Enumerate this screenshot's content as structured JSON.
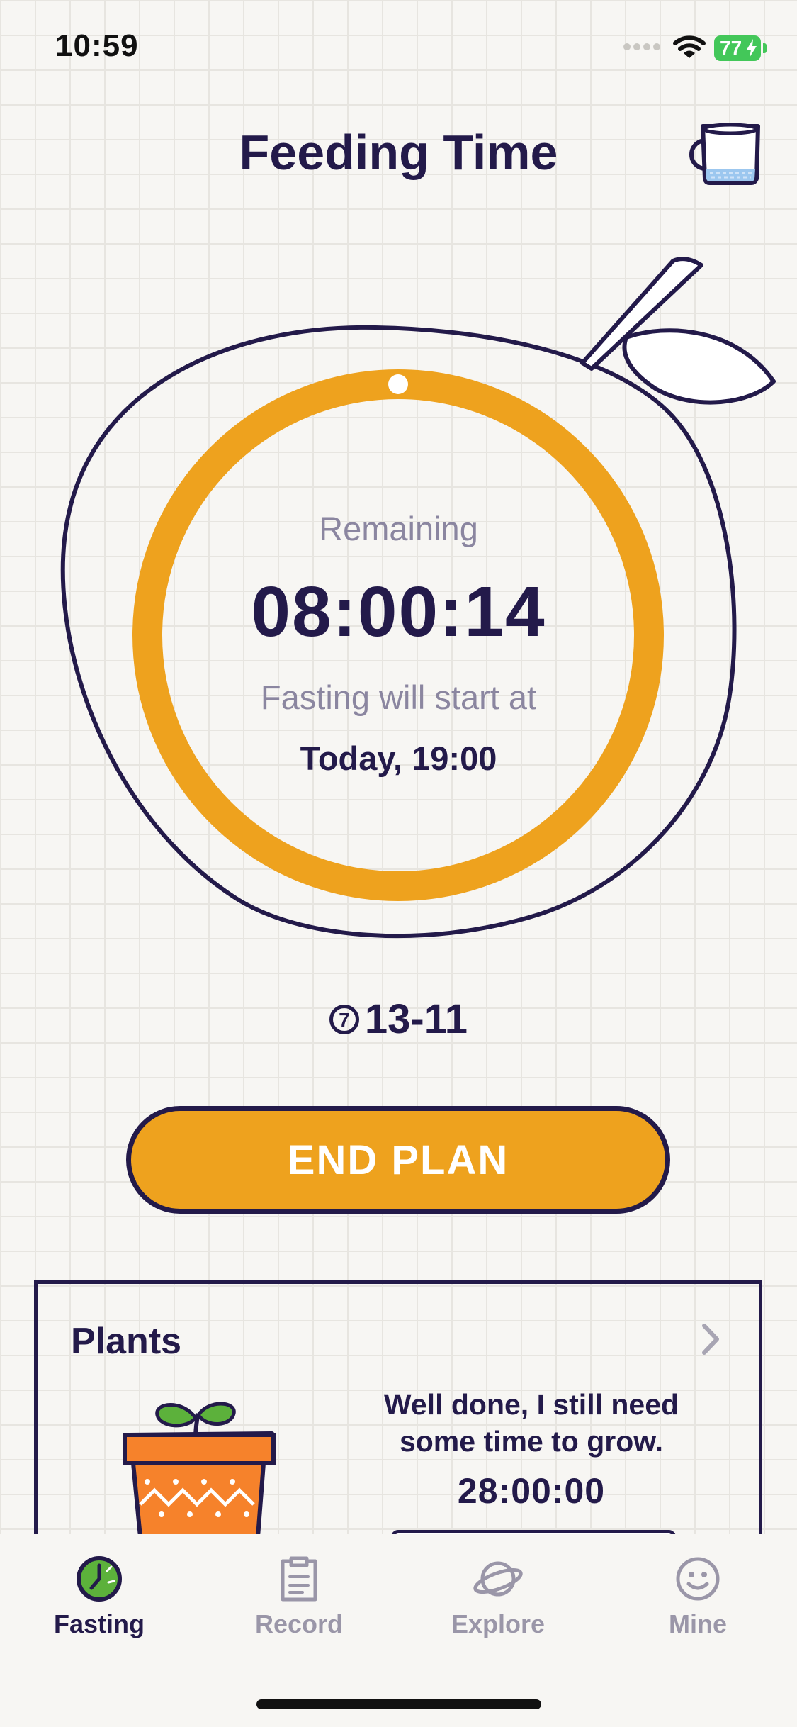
{
  "status_bar": {
    "time": "10:59",
    "battery": "77"
  },
  "header": {
    "title": "Feeding Time"
  },
  "timer": {
    "remaining_label": "Remaining",
    "remaining_value": "08:00:14",
    "fasting_label": "Fasting will start at",
    "fasting_start": "Today, 19:00",
    "progress_fraction": 0.0
  },
  "plan": {
    "icon_number": "7",
    "name": "13-11"
  },
  "actions": {
    "end_plan_label": "END PLAN"
  },
  "plants": {
    "title": "Plants",
    "message": "Well done, I still need some time to grow.",
    "time": "28:00:00"
  },
  "tabs": [
    {
      "label": "Fasting",
      "icon": "clock-icon",
      "active": true
    },
    {
      "label": "Record",
      "icon": "clipboard-icon",
      "active": false
    },
    {
      "label": "Explore",
      "icon": "planet-icon",
      "active": false
    },
    {
      "label": "Mine",
      "icon": "smiley-icon",
      "active": false
    }
  ],
  "colors": {
    "accent": "#eea21e",
    "ink": "#231a4a",
    "muted": "#8b86a0",
    "background": "#f7f6f3",
    "battery": "#43c759",
    "pot": "#f6822b",
    "leaf": "#5cb13b"
  }
}
